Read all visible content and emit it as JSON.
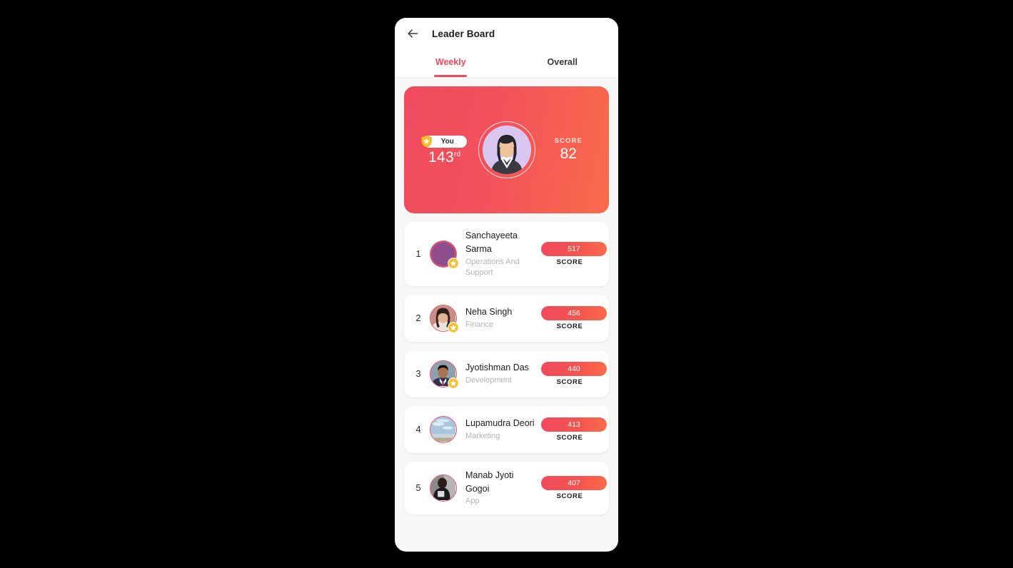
{
  "header": {
    "back_icon": "arrow-left-icon",
    "title": "Leader Board"
  },
  "tabs": [
    {
      "label": "Weekly",
      "active": true
    },
    {
      "label": "Overall",
      "active": false
    }
  ],
  "hero": {
    "badge_icon": "star-shield-icon",
    "badge_label": "You",
    "rank_number": "143",
    "rank_suffix": "rd",
    "avatar_icon": "user-avatar-female",
    "score_label": "SCORE",
    "score_value": "82",
    "gradient_from": "#ef4a5e",
    "gradient_to": "#fa6b4a"
  },
  "leaderboard": {
    "score_caption": "SCORE",
    "rows": [
      {
        "rank": "1",
        "name": "Sanchayeeta Sarma",
        "department": "Operations And Support",
        "score": "517",
        "has_star": true,
        "avatar_kind": "plain-purple"
      },
      {
        "rank": "2",
        "name": "Neha Singh",
        "department": "Finance",
        "score": "456",
        "has_star": true,
        "avatar_kind": "photo-woman"
      },
      {
        "rank": "3",
        "name": "Jyotishman Das",
        "department": "Development",
        "score": "440",
        "has_star": true,
        "avatar_kind": "photo-man-suit"
      },
      {
        "rank": "4",
        "name": "Lupamudra Deori",
        "department": "Marketing",
        "score": "413",
        "has_star": false,
        "avatar_kind": "photo-sky"
      },
      {
        "rank": "5",
        "name": "Manab Jyoti Gogoi",
        "department": "App",
        "score": "407",
        "has_star": false,
        "avatar_kind": "photo-dark"
      }
    ]
  },
  "colors": {
    "accent": "#ef4a5e",
    "accent_orange": "#fa6b4a",
    "page_bg": "#f7f7f8",
    "card_bg": "#ffffff",
    "muted_text": "#b4b4b8"
  }
}
